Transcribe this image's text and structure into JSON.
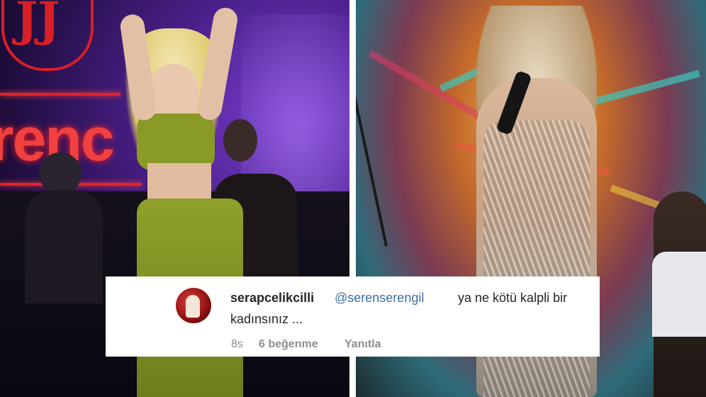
{
  "photos": {
    "left": {
      "logo_text": "JJ",
      "sign_text": "renc"
    },
    "right": {}
  },
  "comment": {
    "username": "serapcelikcilli",
    "mention": "@serenserengil",
    "text_line1": "ya ne kötü kalpli bir",
    "text_line2": "kadınsınız ...",
    "time": "8s",
    "likes": "6 beğenme",
    "reply_label": "Yanıtla"
  },
  "colors": {
    "mention": "#3a6ea8",
    "meta": "#8e8e8e",
    "neon_red": "#e0242a"
  }
}
